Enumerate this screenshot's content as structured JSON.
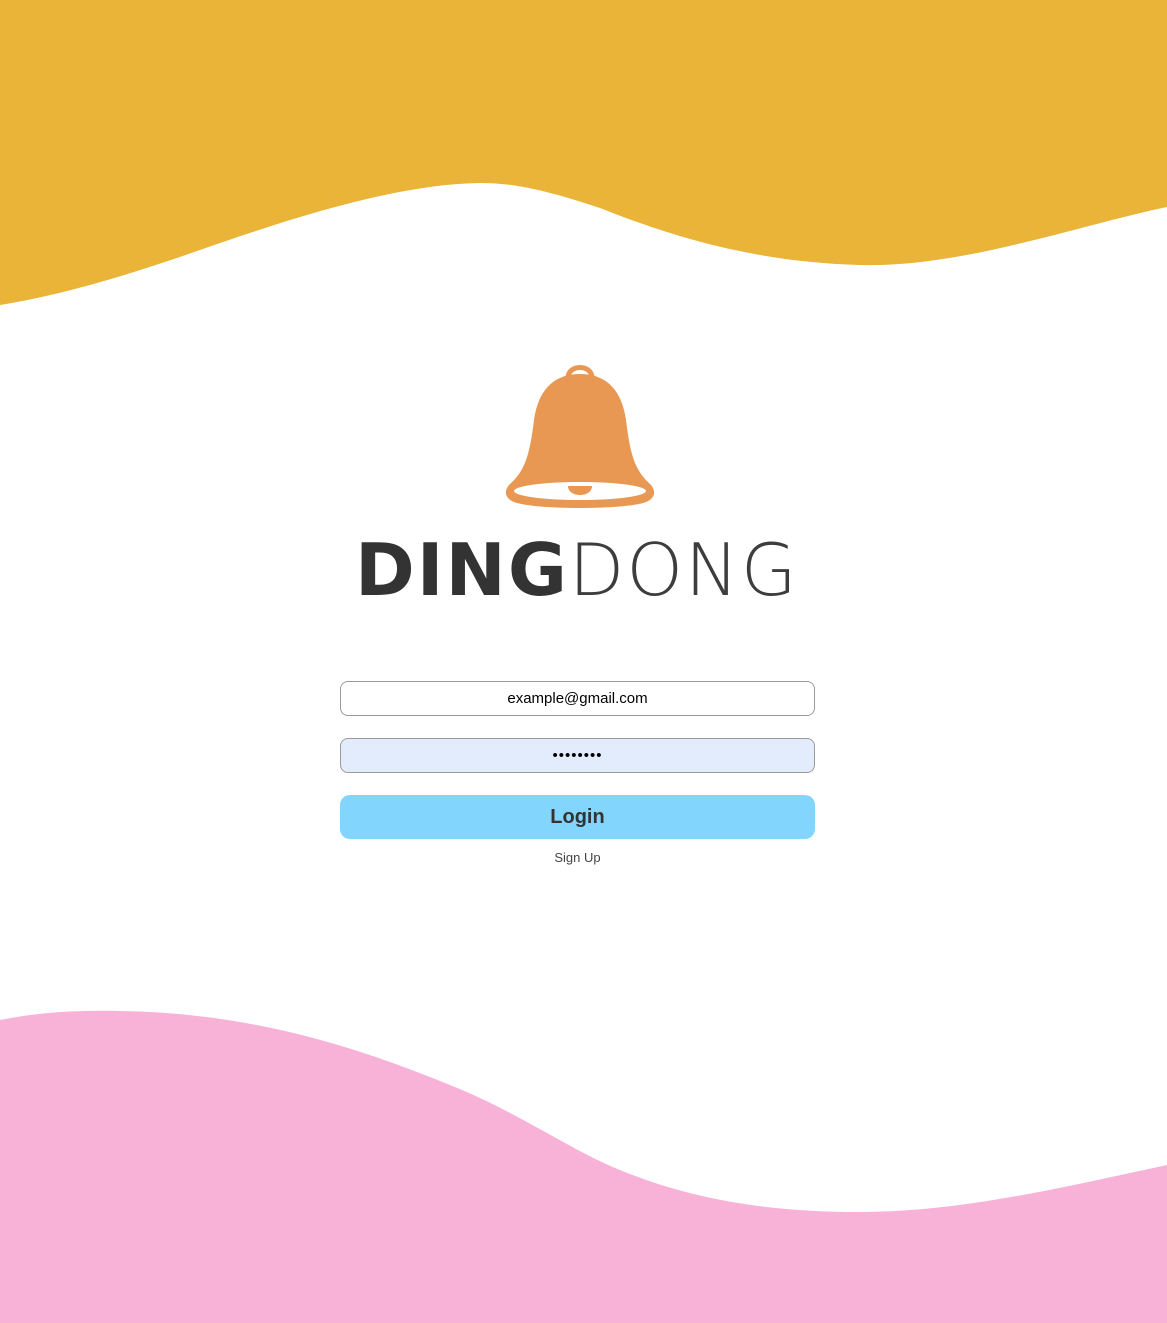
{
  "colors": {
    "top_wave": "#E9B437",
    "bottom_wave": "#F8B2D8",
    "bell": "#E89852",
    "login_button": "#82D5FC",
    "password_field_bg": "#E3ECFC",
    "wordmark": "#333333"
  },
  "logo": {
    "icon": "bell-icon",
    "wordmark_bold": "DING",
    "wordmark_light": "DONG"
  },
  "form": {
    "email_value": "example@gmail.com",
    "password_value": "••••••••",
    "login_label": "Login",
    "signup_label": "Sign Up"
  }
}
